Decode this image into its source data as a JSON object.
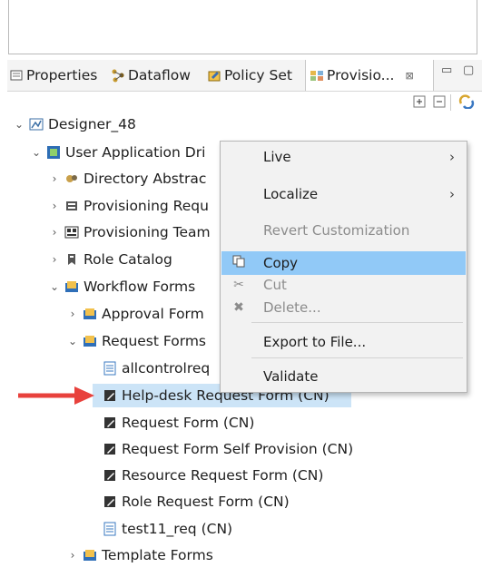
{
  "tabs": [
    {
      "label": "Properties",
      "icon": "properties-icon"
    },
    {
      "label": "Dataflow",
      "icon": "dataflow-icon"
    },
    {
      "label": "Policy Set",
      "icon": "policy-set-icon"
    },
    {
      "label": "Provisio...",
      "icon": "provisioning-icon"
    }
  ],
  "tab_close": "⊠",
  "window": {
    "minimize": "▭",
    "maximize": "▢"
  },
  "tree": {
    "root": "Designer_48",
    "driver": "User Application Dri",
    "items": {
      "directory": "Directory Abstrac",
      "prov_req": "Provisioning Requ",
      "prov_team": "Provisioning Team",
      "role_catalog": "Role Catalog",
      "workflow_forms": "Workflow Forms",
      "approval_forms": "Approval Form",
      "request_forms": "Request Forms",
      "allcontrol": "allcontrolreq",
      "helpdesk": "Help-desk Request Form (CN)",
      "request_form": "Request Form (CN)",
      "self_provision": "Request Form Self Provision (CN)",
      "resource_request": "Resource Request Form (CN)",
      "role_request": "Role Request Form (CN)",
      "test11": "test11_req (CN)",
      "template_forms": "Template Forms"
    }
  },
  "context_menu": {
    "live": "Live",
    "localize": "Localize",
    "revert": "Revert Customization",
    "copy": "Copy",
    "cut": "Cut",
    "delete": "Delete...",
    "export": "Export to File...",
    "validate": "Validate"
  },
  "colors": {
    "selection": "#cce4f7",
    "menu_highlight": "#91c9f7",
    "arrow": "#e8413c"
  }
}
